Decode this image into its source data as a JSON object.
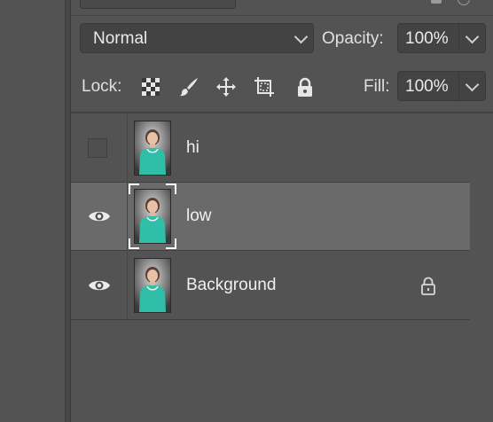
{
  "blend_mode": {
    "value": "Normal"
  },
  "opacity": {
    "label": "Opacity:",
    "value": "100%"
  },
  "lock": {
    "label": "Lock:"
  },
  "fill": {
    "label": "Fill:",
    "value": "100%"
  },
  "layers": [
    {
      "name": "hi",
      "visible": false,
      "selected": false,
      "locked": false
    },
    {
      "name": "low",
      "visible": true,
      "selected": true,
      "locked": false
    },
    {
      "name": "Background",
      "visible": true,
      "selected": false,
      "locked": true
    }
  ],
  "colors": {
    "panel_bg": "#535353",
    "selected_row": "#6a6a6a",
    "text": "#e6e6e6"
  }
}
